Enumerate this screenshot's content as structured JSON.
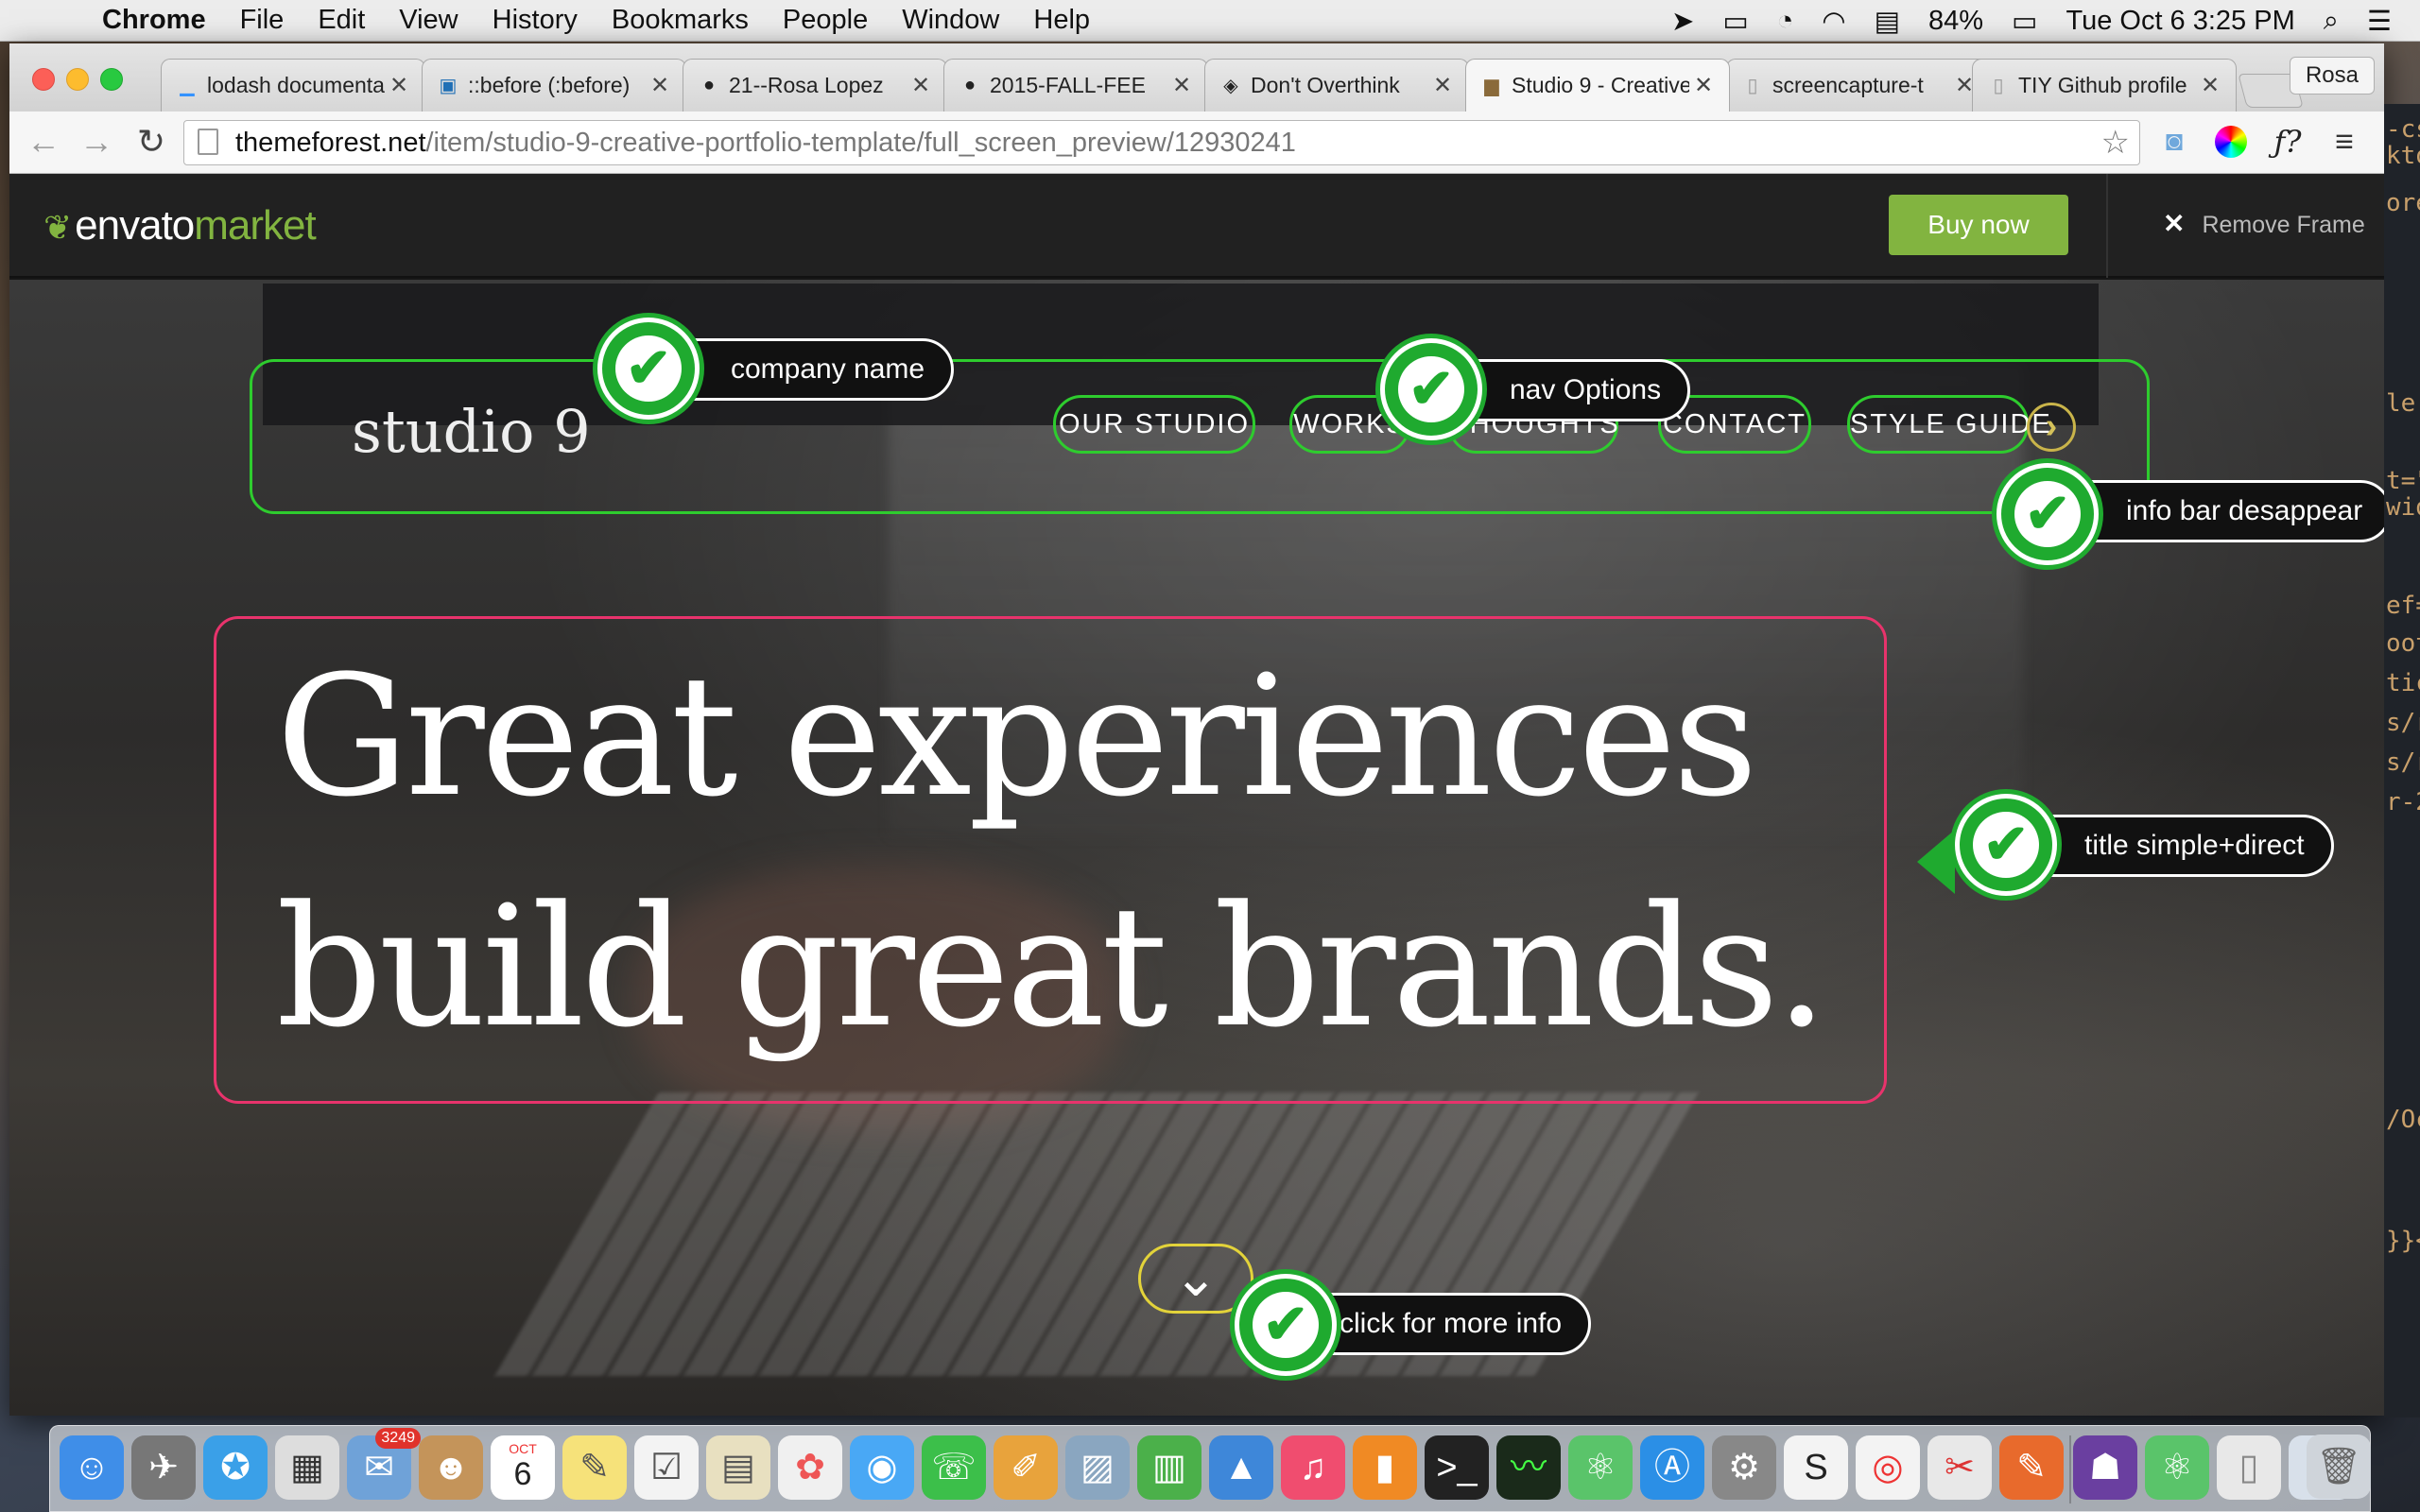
{
  "menubar": {
    "app_name": "Chrome",
    "items": [
      "File",
      "Edit",
      "View",
      "History",
      "Bookmarks",
      "People",
      "Window",
      "Help"
    ],
    "battery": "84%",
    "datetime": "Tue Oct 6  3:25 PM"
  },
  "tabs": [
    {
      "title": "lodash documentation",
      "icon": "lodash-icon"
    },
    {
      "title": "::before (:before)",
      "icon": "mdn-icon"
    },
    {
      "title": "21--Rosa Lopez",
      "icon": "github-icon"
    },
    {
      "title": "2015-FALL-FEE",
      "icon": "github-icon"
    },
    {
      "title": "Don't Overthink",
      "icon": "codepen-icon"
    },
    {
      "title": "Studio 9 - Creative",
      "icon": "studio9-icon"
    },
    {
      "title": "screencapture-t",
      "icon": "doc-icon"
    },
    {
      "title": "TIY Github profile",
      "icon": "doc-icon"
    }
  ],
  "profile_name": "Rosa",
  "address": {
    "host": "themeforest.net",
    "path": "/item/studio-9-creative-portfolio-template/full_screen_preview/12930241"
  },
  "envato": {
    "logo_word1": "envato",
    "logo_word2": "market",
    "buy_now": "Buy now",
    "remove_frame": "Remove Frame"
  },
  "site": {
    "name": "studio 9",
    "nav": [
      "OUR STUDIO",
      "WORKS",
      "THOUGHTS",
      "CONTACT",
      "STYLE GUIDE"
    ],
    "headline_line1": "Great experiences",
    "headline_line2": "build great brands."
  },
  "annotations": [
    {
      "label": "company name"
    },
    {
      "label": "nav Options"
    },
    {
      "label": "info bar desappear"
    },
    {
      "label": "title simple+direct"
    },
    {
      "label": "click for more info"
    }
  ],
  "editor_snippets": [
    "-cs",
    "kto",
    "ore",
    "le'",
    "t=\"",
    "wid",
    "ef=",
    "oot",
    "tic",
    "s/r",
    "s/r",
    "r-2",
    "/Oc",
    "}}<"
  ],
  "dock": {
    "calendar_month": "OCT",
    "calendar_day": "6",
    "mail_badge": "3249"
  }
}
